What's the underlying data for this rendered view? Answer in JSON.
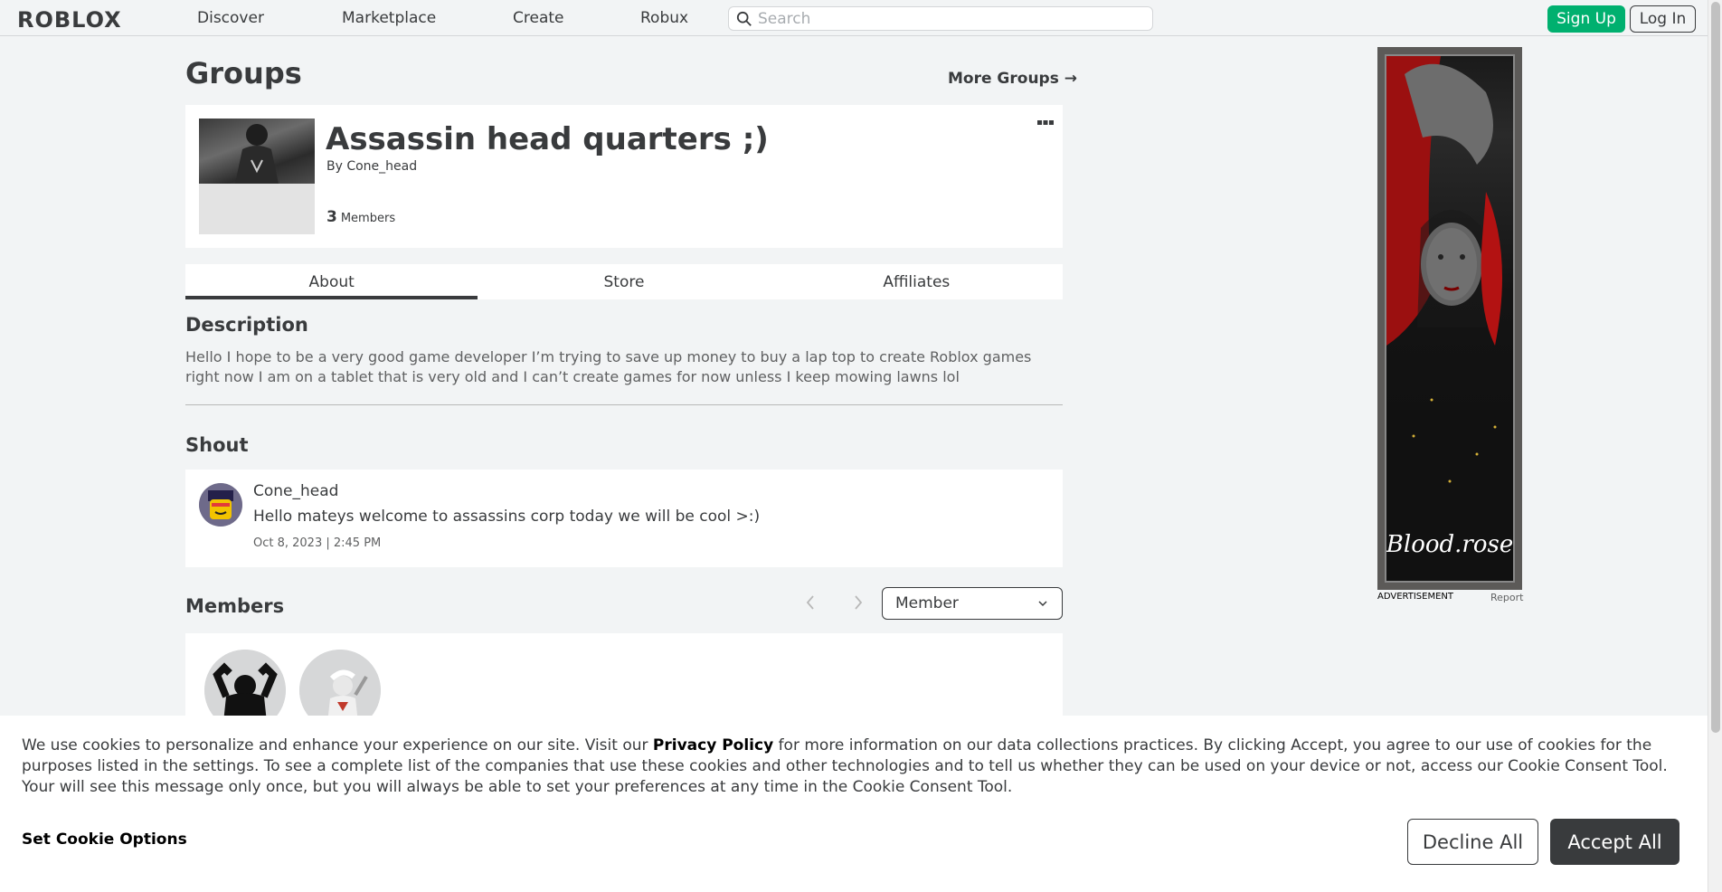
{
  "nav": {
    "logo": "ROBLOX",
    "links": [
      "Discover",
      "Marketplace",
      "Create",
      "Robux"
    ],
    "search_placeholder": "Search",
    "signup_label": "Sign Up",
    "login_label": "Log In"
  },
  "page": {
    "title": "Groups",
    "more_groups": "More Groups →"
  },
  "group": {
    "name": "Assassin head quarters ;)",
    "by_prefix": "By",
    "owner": "Cone_head",
    "member_count": "3",
    "members_label": "Members"
  },
  "tabs": [
    {
      "label": "About",
      "active": true
    },
    {
      "label": "Store",
      "active": false
    },
    {
      "label": "Affiliates",
      "active": false
    }
  ],
  "description": {
    "title": "Description",
    "text": "Hello I hope to be a very good game developer I’m trying to save up money to buy a lap top to create Roblox games right now I am on a tablet that is very old and I can’t create games for now unless I keep mowing lawns lol"
  },
  "shout": {
    "title": "Shout",
    "user": "Cone_head",
    "body": "Hello mateys welcome to assassins corp today we will be cool >:)",
    "date": "Oct 8, 2023 | 2:45 PM"
  },
  "members": {
    "title": "Members",
    "role_selected": "Member"
  },
  "ad": {
    "label": "ADVERTISEMENT",
    "report": "Report",
    "signature": "Blood.rose"
  },
  "cookie": {
    "text_before": "We use cookies to personalize and enhance your experience on our site. Visit our ",
    "link": "Privacy Policy",
    "text_after": " for more information on our data collections practices. By clicking Accept, you agree to our use of cookies for the purposes listed in the settings. To see a complete list of the companies that use these cookies and other technologies and to tell us whether they can be used on your device or not, access our Cookie Consent Tool. Your will see this message only once, but you will always be able to set your preferences at any time in the Cookie Consent Tool.",
    "options_label": "Set Cookie Options",
    "decline_label": "Decline All",
    "accept_label": "Accept All"
  },
  "colors": {
    "page_bg": "#f2f4f5",
    "signup_green": "#00b06f",
    "text_dark": "#393b3d",
    "accept_bg": "#393b3d"
  }
}
